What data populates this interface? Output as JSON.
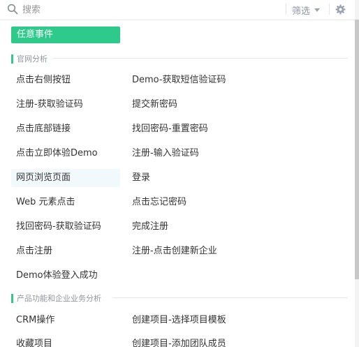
{
  "search": {
    "placeholder": "搜索",
    "value": ""
  },
  "filter": {
    "label": "筛选"
  },
  "any_event": {
    "label": "任意事件"
  },
  "sections": [
    {
      "title": "官网分析",
      "items": [
        "点击右侧按钮",
        "Demo-获取短信验证码",
        "注册-获取验证码",
        "提交新密码",
        "点击底部链接",
        "找回密码-重置密码",
        "点击立即体验Demo",
        "注册-输入验证码",
        "网页浏览页面",
        "登录",
        "Web 元素点击",
        "点击忘记密码",
        "找回密码-获取验证码",
        "完成注册",
        "点击注册",
        "注册-点击创建新企业",
        "Demo体验登入成功"
      ]
    },
    {
      "title": "产品功能和企业业务分析",
      "items": [
        "CRM操作",
        "创建项目-选择项目模板",
        "收藏项目",
        "创建项目-添加团队成员"
      ]
    }
  ],
  "colors": {
    "accent": "#2dca8c",
    "hover_bg": "#f2f9fd"
  },
  "icons": {
    "search": "search-icon",
    "filter_caret": "caret-down-icon",
    "settings": "gear-icon"
  }
}
